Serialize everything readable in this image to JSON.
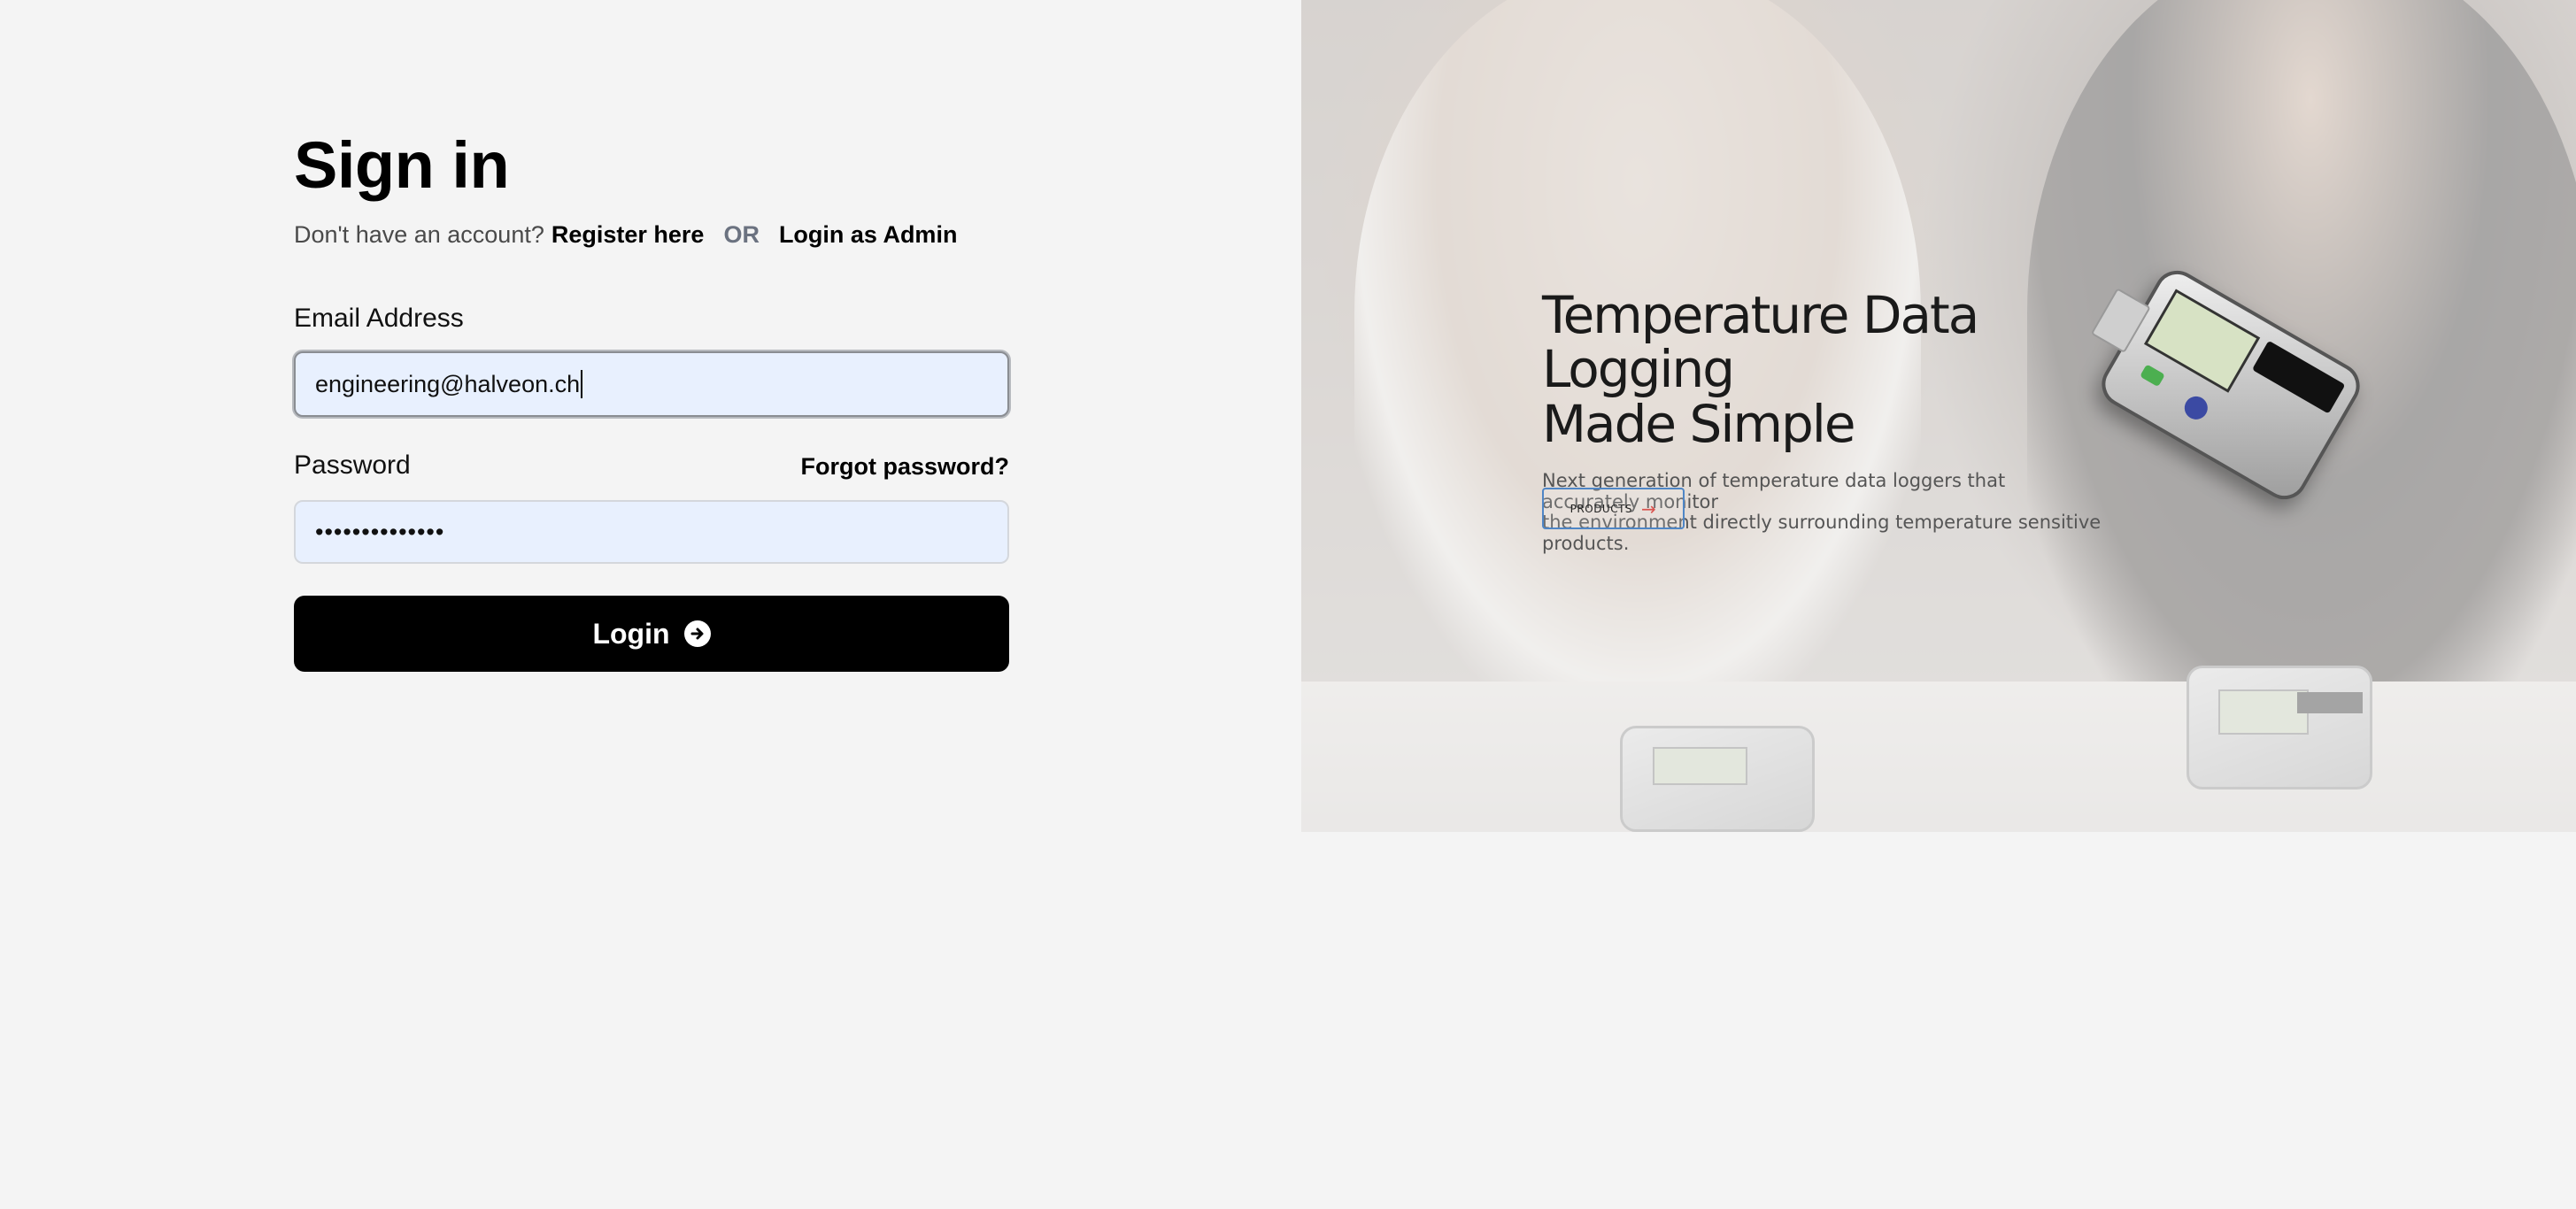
{
  "signin": {
    "title": "Sign in",
    "no_account_text": "Don't have an account?",
    "register_link": "Register here",
    "or_text": "OR",
    "admin_link": "Login as Admin"
  },
  "form": {
    "email_label": "Email Address",
    "email_value": "engineering@halveon.ch",
    "password_label": "Password",
    "forgot_link": "Forgot password?",
    "password_value": "••••••••••••••",
    "login_label": "Login",
    "login_icon": "arrow-right-circle-icon"
  },
  "hero": {
    "title_line1": "Temperature Data Logging",
    "title_line2": "Made Simple",
    "desc_line1": "Next generation of temperature data loggers that accurately monitor",
    "desc_line2": "the environment directly surrounding temperature sensitive products.",
    "products_button": "PRODUCTS",
    "products_icon": "arrow-right-icon"
  },
  "colors": {
    "background": "#f4f4f4",
    "input_bg": "#e8f0fe",
    "button_bg": "#000000",
    "products_border": "#4f86c6",
    "products_arrow": "#d9534f"
  }
}
